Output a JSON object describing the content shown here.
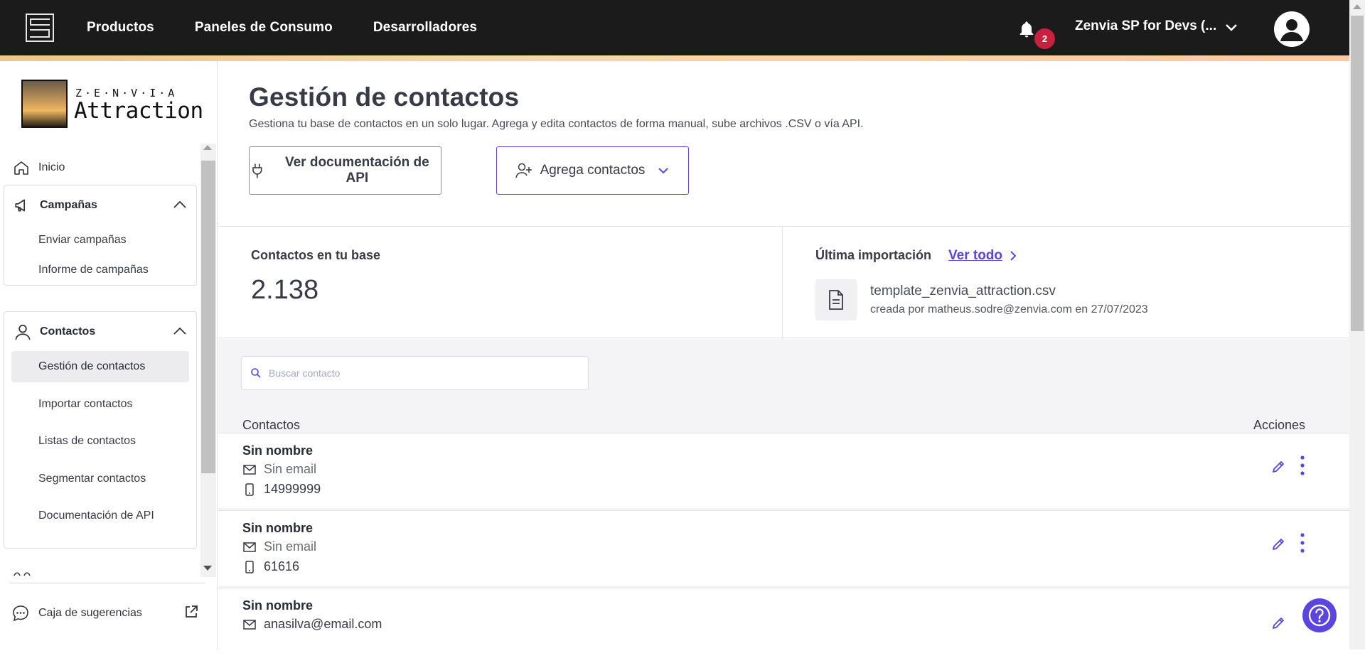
{
  "topbar": {
    "nav": [
      "Productos",
      "Paneles de Consumo",
      "Desarrolladores"
    ],
    "notifications_count": "2",
    "account_name": "Zenvia SP for Devs (..."
  },
  "brand": {
    "small": "Z·E·N·V·I·A",
    "large": "Attraction"
  },
  "sidebar": {
    "home": "Inicio",
    "campaigns": {
      "title": "Campañas",
      "items": [
        "Enviar campañas",
        "Informe de campañas"
      ]
    },
    "contacts": {
      "title": "Contactos",
      "items": [
        "Gestión de contactos",
        "Importar contactos",
        "Listas de contactos",
        "Segmentar contactos",
        "Documentación de API"
      ],
      "active_index": 0
    },
    "suggestions": "Caja de sugerencias"
  },
  "main": {
    "title": "Gestión de contactos",
    "description": "Gestiona tu base de contactos en un solo lugar. Agrega y edita contactos de forma manual, sube archivos .CSV o vía API.",
    "btn_api": "Ver documentación de API",
    "btn_add": "Agrega contactos"
  },
  "stats": {
    "contacts_label": "Contactos en tu base",
    "contacts_value": "2.138",
    "import_label": "Última importación",
    "import_link": "Ver todo",
    "file_name": "template_zenvia_attraction.csv",
    "file_meta": "creada por matheus.sodre@zenvia.com en 27/07/2023"
  },
  "list": {
    "search_placeholder": "Buscar contacto",
    "col_contacts": "Contactos",
    "col_actions": "Acciones",
    "rows": [
      {
        "name": "Sin nombre",
        "email": "Sin email",
        "phone": "14999999"
      },
      {
        "name": "Sin nombre",
        "email": "Sin email",
        "phone": "61616"
      },
      {
        "name": "Sin nombre",
        "email": "anasilva@email.com",
        "phone": ""
      }
    ]
  },
  "colors": {
    "accent": "#5b45e0",
    "topbar": "#1b1b1b",
    "badge": "#c8203f"
  }
}
